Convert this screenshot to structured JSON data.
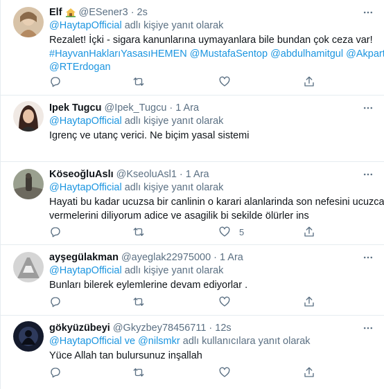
{
  "tweets": [
    {
      "name": "Elf",
      "handle": "@ESener3",
      "time": "2s",
      "avatar_color": "#c9a27a",
      "reply_prefix": "",
      "reply_links": "@HaytapOfficial",
      "reply_suffix": " adlı kişiye yanıt olarak",
      "lines": [
        "Rezalet! İçki - sigara kanunlarına uymayanlara bile bundan çok ceza var!",
        "#HayvanHaklarıYasasıHEMEN @MustafaSentop @abdulhamitgul @Akparti",
        "@RTErdogan"
      ],
      "like_count": ""
    },
    {
      "name": "Ipek Tugcu",
      "handle": "@Ipek_Tugcu",
      "time": "1 Ara",
      "avatar_color": "#5a3a2e",
      "reply_links": "@HaytapOfficial",
      "reply_suffix": " adlı kişiye yanıt olarak",
      "lines": [
        "Igrenç ve utanç verici. Ne biçim yasal sistemi"
      ],
      "like_count": ""
    },
    {
      "name": "KöseoğluAslı",
      "handle": "@KseoluAsl1",
      "time": "1 Ara",
      "avatar_color": "#7b7f76",
      "reply_links": "@HaytapOfficial",
      "reply_suffix": " adlı kişiye yanıt olarak",
      "lines": [
        "Hayati bu kadar ucuzsa bir canlinin o karari alanlarinda son nefesini ucuzca",
        "vermelerini diliyorum adice ve asagilik bi sekilde ölürler ins"
      ],
      "like_count": "5"
    },
    {
      "name": "ayşegülakman",
      "handle": "@ayeglak22975000",
      "time": "1 Ara",
      "avatar_color": "#b9b9b9",
      "reply_links": "@HaytapOfficial",
      "reply_suffix": " adlı kişiye yanıt olarak",
      "lines": [
        "Bunları bilerek eylemlerine devam ediyorlar ."
      ],
      "like_count": ""
    },
    {
      "name": "gökyüzübeyi",
      "handle": "@Gkyzbey78456711",
      "time": "12s",
      "avatar_color": "#1c2236",
      "reply_links": "@HaytapOfficial ve @nilsmkr",
      "reply_suffix": " adlı kullanıcılara yanıt olarak",
      "lines": [
        "Yüce Allah tan bulursunuz inşallah"
      ],
      "like_count": ""
    }
  ],
  "separator": "·",
  "icons": {
    "reply": "reply-icon",
    "retweet": "retweet-icon",
    "like": "heart-icon",
    "share": "share-icon",
    "more": "more-icon"
  }
}
